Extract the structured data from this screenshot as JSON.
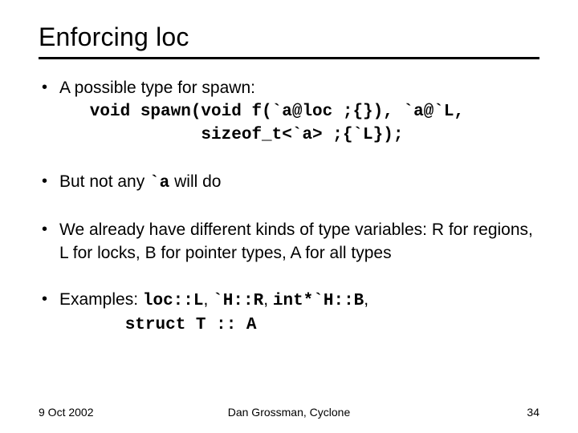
{
  "title": "Enforcing loc",
  "bullets": {
    "b1": {
      "lead": "A possible type for spawn:",
      "code": "   void spawn(void f(`a@loc ;{}), `a@`L,\n              sizeof_t<`a> ;{`L});"
    },
    "b2": {
      "pre": "But not any ",
      "code": "`a",
      "post": " will do"
    },
    "b3": "We already have different kinds of type variables: R for regions, L for locks, B for pointer types, A for all types",
    "b4": {
      "label": "Examples: ",
      "ex1": "loc::L",
      "ex2": "`H::R",
      "ex3": "int*`H::B",
      "ex4": "struct T :: A"
    }
  },
  "footer": {
    "date": "9 Oct 2002",
    "author": "Dan Grossman, Cyclone",
    "page": "34"
  }
}
